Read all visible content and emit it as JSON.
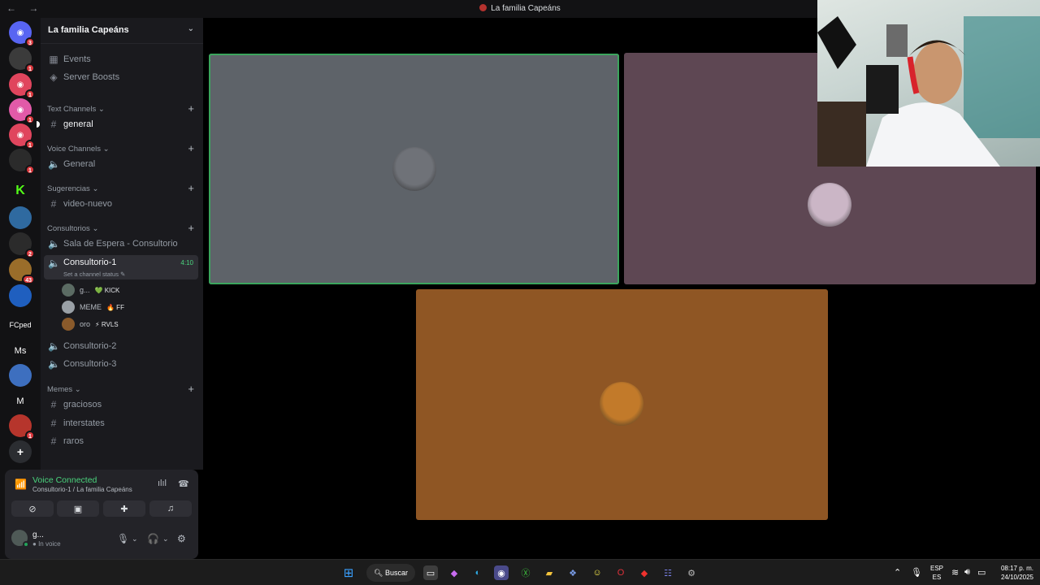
{
  "window": {
    "title": "La familia Capeáns",
    "nav_icons": "← →"
  },
  "guilds": [
    {
      "name": "discord-home",
      "badge": "3",
      "color": "#5865f2",
      "glyph": "◉"
    },
    {
      "name": "guild-2",
      "badge": "1",
      "color": "#3b3b3b",
      "glyph": ""
    },
    {
      "name": "guild-3",
      "badge": "1",
      "color": "#e0455d",
      "glyph": "◉"
    },
    {
      "name": "guild-4",
      "badge": "1",
      "color": "#e25aa8",
      "glyph": "◉"
    },
    {
      "name": "guild-5",
      "badge": "1",
      "color": "#e0455d",
      "glyph": "◉"
    },
    {
      "name": "guild-6",
      "badge": "1",
      "color": "#2b2b2b",
      "glyph": ""
    },
    {
      "name": "guild-kick",
      "badge": "",
      "color": "#121214",
      "glyph": "K"
    },
    {
      "name": "guild-8",
      "badge": "",
      "color": "#2f6aa0",
      "glyph": ""
    },
    {
      "name": "guild-9",
      "badge": "2",
      "color": "#2b2b2b",
      "glyph": ""
    },
    {
      "name": "guild-10",
      "badge": "43",
      "color": "#9a6d2a",
      "glyph": ""
    },
    {
      "name": "guild-11",
      "badge": "",
      "color": "#1f5fbf",
      "glyph": ""
    },
    {
      "name": "guild-fcped",
      "badge": "",
      "color": "#121214",
      "glyph": "FCped"
    },
    {
      "name": "guild-ms",
      "badge": "",
      "color": "#121214",
      "glyph": "Ms"
    },
    {
      "name": "guild-14",
      "badge": "",
      "color": "#3d6fbf",
      "glyph": ""
    },
    {
      "name": "guild-m",
      "badge": "",
      "color": "#121214",
      "glyph": "M"
    },
    {
      "name": "guild-16",
      "badge": "1",
      "color": "#b6352c",
      "glyph": ""
    },
    {
      "name": "add-server",
      "badge": "",
      "color": "#121214",
      "glyph": "+"
    }
  ],
  "server": {
    "name": "La familia Capeáns",
    "events_label": "Events",
    "boosts_label": "Server Boosts"
  },
  "categories": {
    "text": "Text Channels",
    "voice": "Voice Channels",
    "sugerencias": "Sugerencias",
    "consultorios": "Consultorios",
    "memes": "Memes"
  },
  "channels": {
    "general_text": "general",
    "general_voice": "General",
    "video_nuevo": "video-nuevo",
    "sala_espera": "Sala de Espera - Consultorio",
    "consultorio_1": "Consultorio-1",
    "consultorio_1_time": "4:10",
    "consultorio_1_status": "Set a channel status",
    "consultorio_2": "Consultorio-2",
    "consultorio_3": "Consultorio-3",
    "graciosos": "graciosos",
    "interstates": "interstates",
    "raros": "raros"
  },
  "members": [
    {
      "name": "g...",
      "tag": "💚 KICK",
      "color": "#5b6b63"
    },
    {
      "name": "MEME",
      "tag": "🔥 FF",
      "color": "#9aa0a6"
    },
    {
      "name": "oro",
      "tag": "⚡ RVLS",
      "color": "#8a5a2b"
    }
  ],
  "voice": {
    "status": "Voice Connected",
    "location": "Consultorio-1 / La familia Capeáns"
  },
  "user": {
    "name": "g...",
    "status": "In voice"
  },
  "tiles": [
    {
      "color": "#5e6369",
      "avatar": "#6f7278",
      "speaking": true
    },
    {
      "color": "#5e4753",
      "avatar": "#cbb6c6",
      "speaking": false
    },
    {
      "color": "#8f5624",
      "avatar": "#c27a2a",
      "speaking": false
    }
  ],
  "taskbar": {
    "search_label": "Buscar",
    "lang_top": "ESP",
    "lang_bottom": "ES",
    "time": "08:17 p. m.",
    "date": "24/10/2025"
  },
  "colors": {
    "speaking_outline": "#3ba55d",
    "accent": "#5865f2",
    "voice_green": "#4ad47d"
  }
}
